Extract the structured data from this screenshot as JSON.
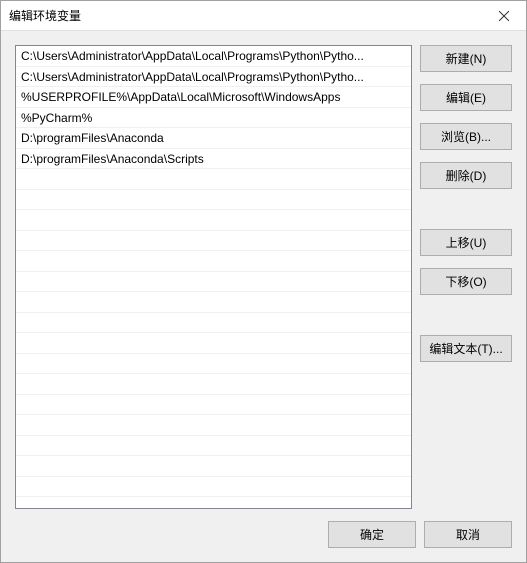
{
  "titlebar": {
    "title": "编辑环境变量"
  },
  "list": {
    "items": [
      "C:\\Users\\Administrator\\AppData\\Local\\Programs\\Python\\Pytho...",
      "C:\\Users\\Administrator\\AppData\\Local\\Programs\\Python\\Pytho...",
      "%USERPROFILE%\\AppData\\Local\\Microsoft\\WindowsApps",
      "%PyCharm%",
      "D:\\programFiles\\Anaconda",
      "D:\\programFiles\\Anaconda\\Scripts"
    ]
  },
  "buttons": {
    "new": "新建(N)",
    "edit": "编辑(E)",
    "browse": "浏览(B)...",
    "delete": "删除(D)",
    "moveup": "上移(U)",
    "movedown": "下移(O)",
    "edittext": "编辑文本(T)...",
    "ok": "确定",
    "cancel": "取消"
  }
}
